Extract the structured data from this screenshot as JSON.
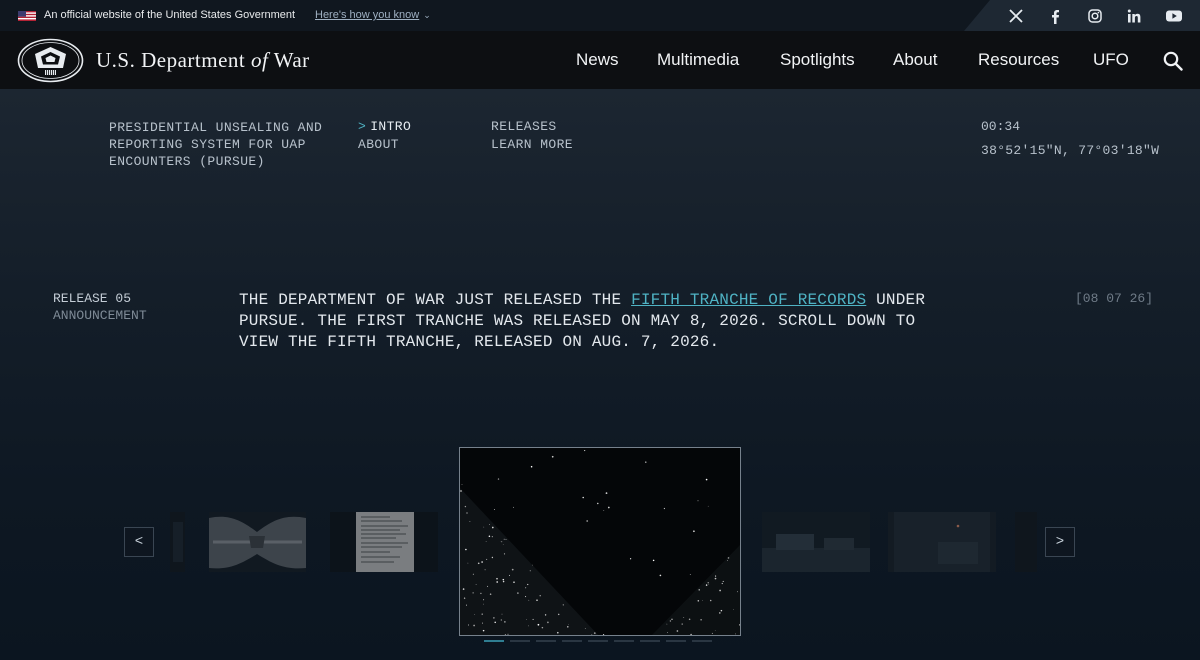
{
  "gov_banner": {
    "text": "An official website of the United States Government",
    "link": "Here's how you know"
  },
  "social": [
    "x-icon",
    "facebook-icon",
    "instagram-icon",
    "linkedin-icon",
    "youtube-icon"
  ],
  "header": {
    "title_pre": "U.S. Department ",
    "title_of": "of",
    "title_post": " War",
    "nav": [
      "News",
      "Multimedia",
      "Spotlights",
      "About",
      "Resources",
      "UFO"
    ]
  },
  "pursue": {
    "title": "PRESIDENTIAL UNSEALING AND REPORTING SYSTEM FOR UAP ENCOUNTERS (PURSUE)",
    "subnav": {
      "intro": "INTRO",
      "about": "ABOUT",
      "releases": "RELEASES",
      "learn_more": "LEARN MORE"
    },
    "caret": ">",
    "clock": "00:34",
    "coords": "38°52′15″N, 77°03′18″W"
  },
  "release": {
    "number": "RELEASE 05",
    "label": "ANNOUNCEMENT",
    "text_before": "THE DEPARTMENT OF WAR JUST RELEASED THE ",
    "link": "FIFTH TRANCHE OF RECORDS",
    "text_after": " UNDER PURSUE. THE FIRST TRANCHE WAS RELEASED ON MAY 8, 2026. SCROLL DOWN TO VIEW THE FIFTH TRANCHE, RELEASED ON AUG. 7, 2026.",
    "date": "[08 07 26]"
  },
  "carousel": {
    "prev": "<",
    "next": ">",
    "slide_count": 9,
    "active_slide": 0
  },
  "colors": {
    "accent": "#4fb3c4",
    "background": "#0b1420",
    "header": "#0d0f12"
  }
}
